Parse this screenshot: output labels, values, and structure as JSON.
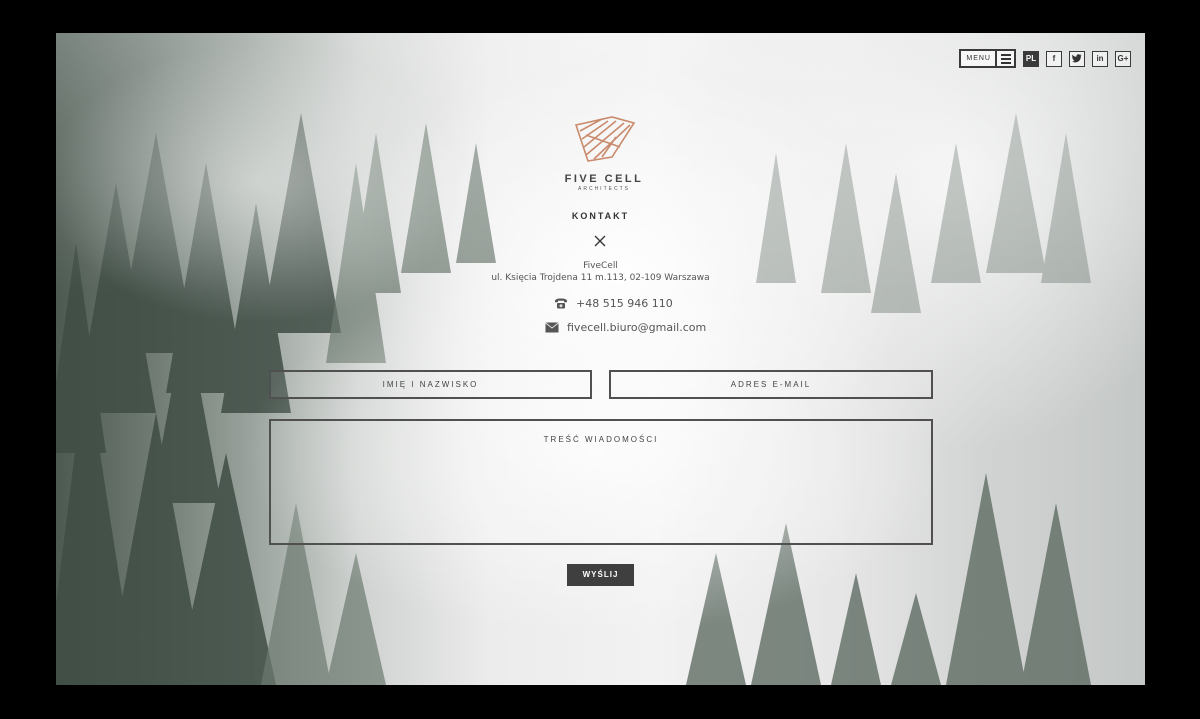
{
  "topbar": {
    "menu_label": "MENU",
    "lang_label": "PL",
    "social": [
      {
        "icon": "facebook-icon",
        "glyph": "f"
      },
      {
        "icon": "twitter-icon",
        "glyph": "t"
      },
      {
        "icon": "linkedin-icon",
        "glyph": "in"
      },
      {
        "icon": "google-plus-icon",
        "glyph": "G+"
      }
    ]
  },
  "logo": {
    "name": "FIVE CELL",
    "subtitle": "ARCHITECTS",
    "color": "#c98a6c"
  },
  "contact": {
    "heading": "KONTAKT",
    "company": "FiveCell",
    "address": "ul. Księcia Trojdena 11 m.113, 02-109 Warszawa",
    "phone": "+48 515 946 110",
    "email": "fivecell.biuro@gmail.com"
  },
  "form": {
    "name_placeholder": "IMIĘ I NAZWISKO",
    "email_placeholder": "ADRES E-MAIL",
    "message_placeholder": "TREŚĆ WIADOMOŚCI",
    "submit_label": "WYŚLIJ"
  }
}
